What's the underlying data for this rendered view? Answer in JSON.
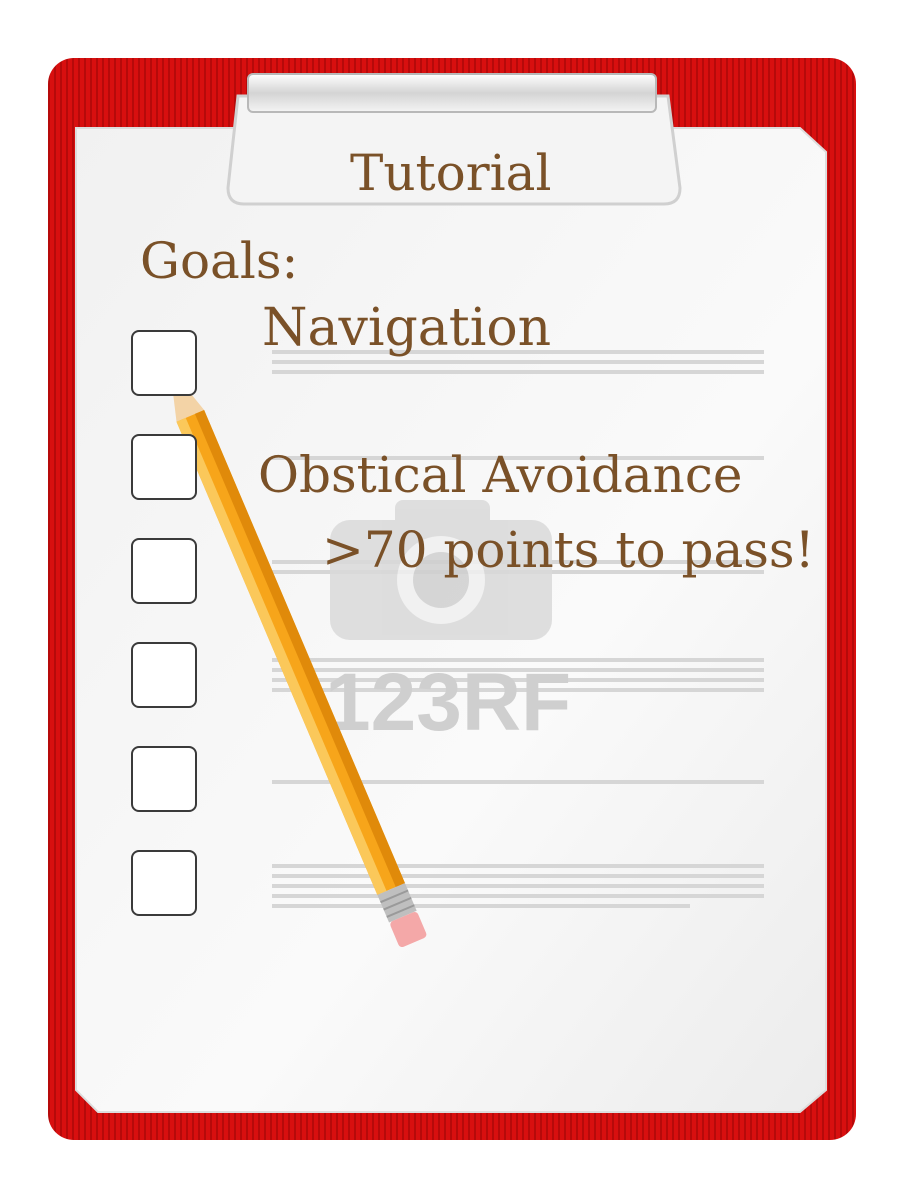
{
  "heading": "Tutorial",
  "goals_label": "Goals:",
  "goals": [
    {
      "label": "Navigation",
      "done": false
    },
    {
      "label": "Obstical Avoidance",
      "done": false
    },
    {
      "label": "",
      "done": false
    },
    {
      "label": "",
      "done": false
    },
    {
      "label": "",
      "done": false
    },
    {
      "label": "",
      "done": false
    }
  ],
  "pass_requirement": ">70 points to pass!",
  "watermark": "123RF",
  "colors": {
    "text": "#7a5128",
    "clipboard": "#d20f0f",
    "paper": "#f6f6f6",
    "pencil": "#f7a51a"
  }
}
